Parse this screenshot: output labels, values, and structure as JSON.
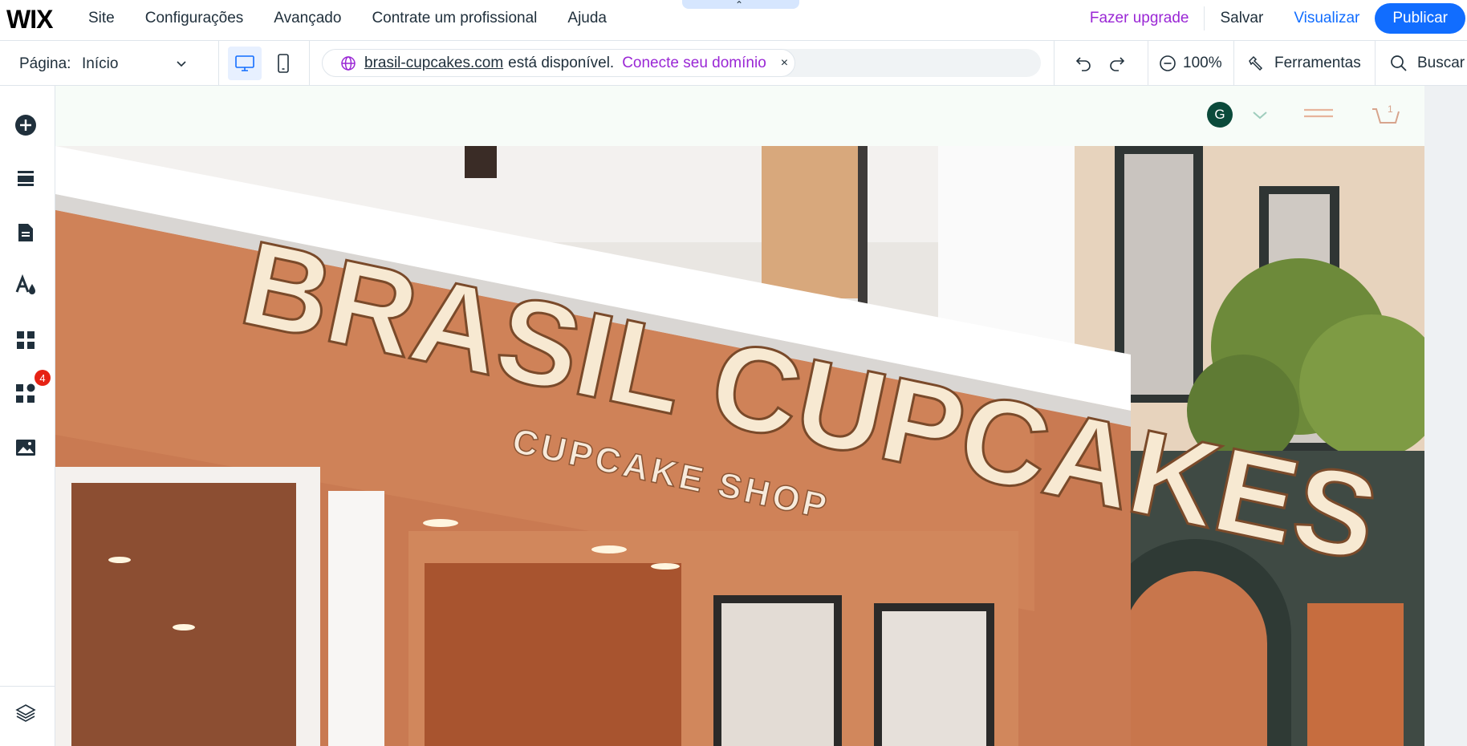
{
  "topbar": {
    "logo": "WIX",
    "menu": [
      "Site",
      "Configurações",
      "Avançado",
      "Contrate um profissional",
      "Ajuda"
    ],
    "upgrade": "Fazer upgrade",
    "save": "Salvar",
    "preview": "Visualizar",
    "publish": "Publicar"
  },
  "toolbar": {
    "page_label": "Página:",
    "page_value": "Início",
    "domain_name": "brasil-cupcakes.com",
    "domain_available": "está disponível.",
    "domain_connect": "Conecte seu domínio",
    "domain_close": "×",
    "zoom": "100%",
    "tools": "Ferramentas",
    "search": "Buscar"
  },
  "leftbar": {
    "icons": [
      "add-icon",
      "sections-icon",
      "pages-icon",
      "theme-icon",
      "apps-icon",
      "business-apps-icon",
      "media-icon",
      "layers-icon"
    ],
    "badge": "4"
  },
  "site": {
    "avatar_letter": "G",
    "cart_count": "1",
    "sign_title": "BRASIL CUPCAKES",
    "sign_subtitle": "CUPCAKE SHOP"
  },
  "colors": {
    "accent": "#116dff",
    "upgrade": "#9a27d5",
    "badge": "#e62214",
    "site_header": "#f7fcf8",
    "storefront": "#c97a52"
  }
}
